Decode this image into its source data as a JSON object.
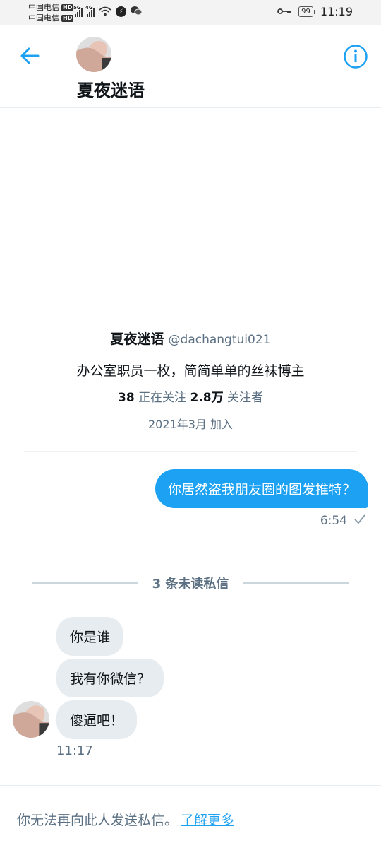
{
  "status_bar": {
    "carrier_1": "中国电信",
    "carrier_2": "中国电信",
    "hd_badge": "HD",
    "sig1_label": "5G",
    "sig2_label": "4G",
    "battery_level": "99",
    "time": "11:19"
  },
  "header": {
    "name": "夏夜迷语",
    "back_icon": "arrow-left-icon",
    "info_icon": "info-circle-icon"
  },
  "profile": {
    "display_name": "夏夜迷语",
    "handle": "@dachangtui021",
    "bio": "办公室职员一枚，简简单单的丝袜博主",
    "following_count": "38",
    "following_label": "正在关注",
    "followers_count": "2.8万",
    "followers_label": "关注者",
    "joined": "2021年3月 加入"
  },
  "conversation": {
    "sent": {
      "text": "你居然盗我朋友圈的图发推特？",
      "time": "6:54",
      "status_icon": "check-icon"
    },
    "unread_divider": "3 条未读私信",
    "received": [
      {
        "text": "你是谁"
      },
      {
        "text": "我有你微信？"
      },
      {
        "text": "傻逼吧！"
      }
    ],
    "received_time": "11:17"
  },
  "footer": {
    "notice": "你无法再向此人发送私信。",
    "link_label": "了解更多"
  },
  "colors": {
    "accent": "#1da1f2",
    "text_primary": "#0f1419",
    "text_secondary": "#5b7083",
    "bubble_received": "#e6ecf0"
  }
}
